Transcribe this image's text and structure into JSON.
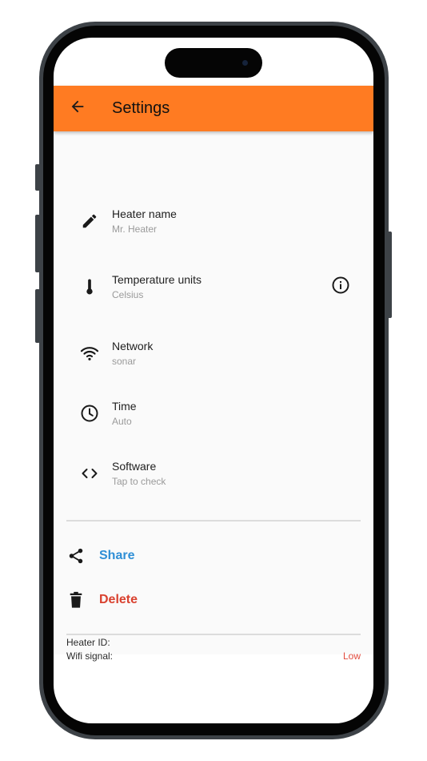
{
  "header": {
    "title": "Settings"
  },
  "settings": [
    {
      "icon": "pencil-icon",
      "title": "Heater name",
      "subtitle": "Mr. Heater"
    },
    {
      "icon": "thermometer-icon",
      "title": "Temperature units",
      "subtitle": "Celsius"
    },
    {
      "icon": "wifi-icon",
      "title": "Network",
      "subtitle": "sonar"
    },
    {
      "icon": "clock-icon",
      "title": "Time",
      "subtitle": "Auto"
    },
    {
      "icon": "code-icon",
      "title": "Software",
      "subtitle": "Tap to check"
    }
  ],
  "actions": {
    "share": {
      "label": "Share",
      "color": "#2f8fd6"
    },
    "delete": {
      "label": "Delete",
      "color": "#d9412f"
    }
  },
  "info": {
    "wifi_signal": {
      "label": "Wifi signal:",
      "value": "Low"
    },
    "heater_id": {
      "label": "Heater ID:",
      "value": ""
    }
  },
  "colors": {
    "appbar": "#ff7b22",
    "background": "#fafafa",
    "warning": "#e24b3e"
  }
}
